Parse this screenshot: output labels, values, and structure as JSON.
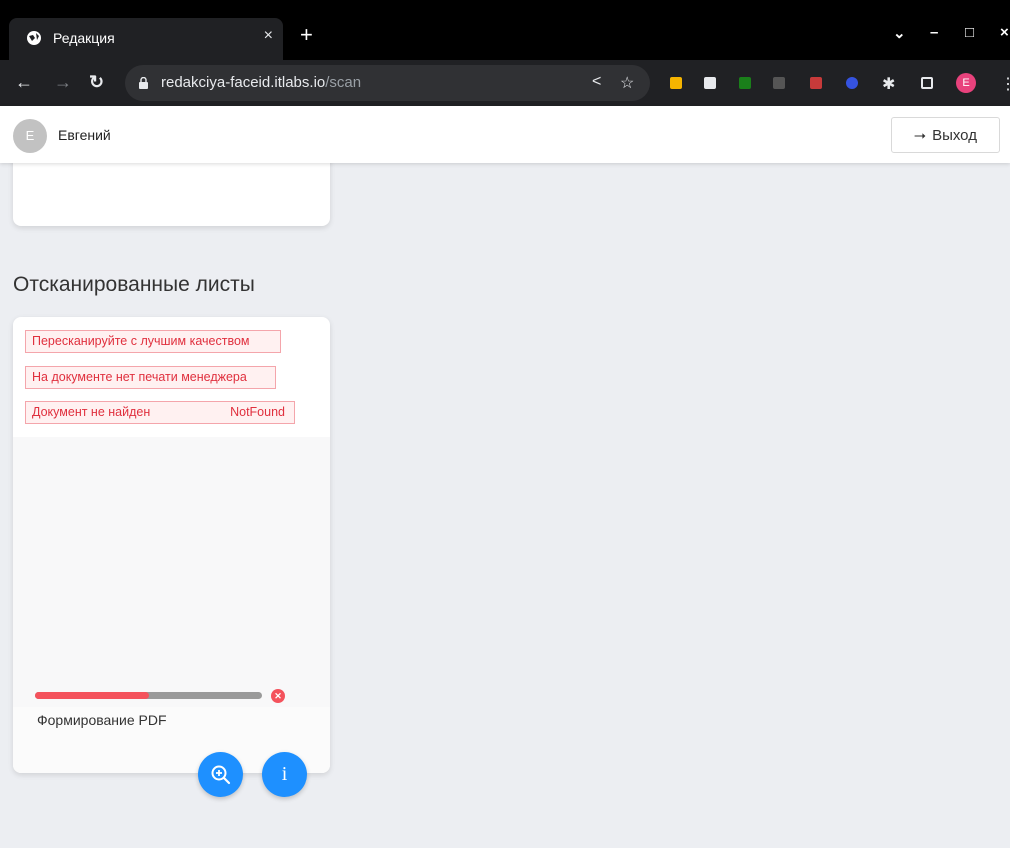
{
  "browser": {
    "tab_title": "Редакция",
    "tab_close": "×",
    "new_tab": "+",
    "url_host": "redakciya-faceid.itlabs.io",
    "url_path": "/scan",
    "profile_initial": "E",
    "window_controls": [
      "⌄",
      "–",
      "□",
      "×"
    ]
  },
  "header": {
    "avatar_initial": "E",
    "username": "Евгений",
    "logout_label": "Выход"
  },
  "section": {
    "title": "Отсканированные листы"
  },
  "scan": {
    "errors": [
      {
        "text": "Пересканируйте с лучшим качеством",
        "code": ""
      },
      {
        "text": "На документе нет печати менеджера",
        "code": ""
      },
      {
        "text": "Документ не найден",
        "code": "NotFound"
      }
    ],
    "progress_label": "Формирование PDF",
    "progress_fraction": 0.5
  },
  "fabs": {
    "zoom_icon": "zoom-in-icon",
    "info_label": "i"
  },
  "colors": {
    "accent": "#1e90ff",
    "error": "#e0303e",
    "progress": "#f4525c"
  }
}
